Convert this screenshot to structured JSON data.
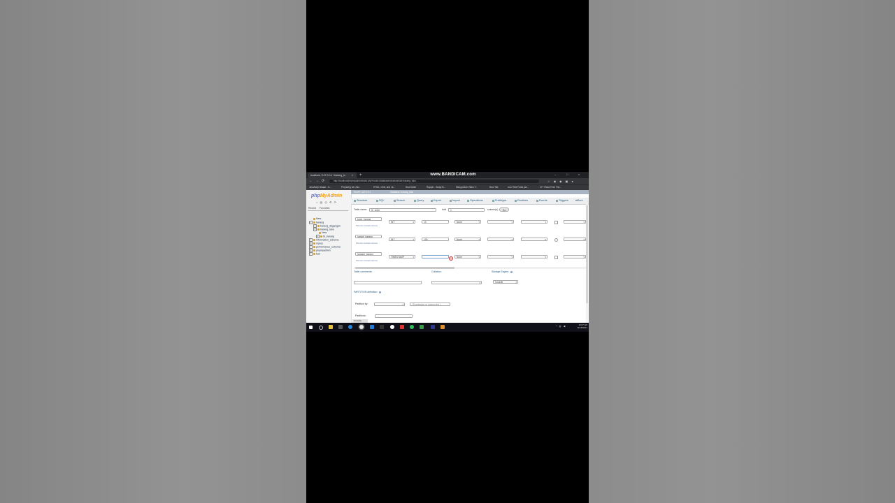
{
  "browser": {
    "tab_title": "localhost / 127.0.0.1 / barang_to",
    "tab_close": "×",
    "new_tab": "+",
    "watermark": "www.BANDICAM.com",
    "window_controls": [
      "–",
      "□",
      "×"
    ],
    "nav_back": "←",
    "nav_forward": "→",
    "nav_reload": "⟳",
    "url": "http://localhost/phpmyadmin/index.php?route=/database/structure&db=barang_toko",
    "bookmarks": [
      "JavaScript Dasar - S...",
      "Preparing for Univ...",
      "HTML, CSS, and Ja...",
      "New folder",
      "Rapper - Sulap B...",
      "Mengunduh Video Y...",
      "New Tab",
      "Cool Text Fonts (ae...",
      "27+ React Free The..."
    ]
  },
  "sidebar": {
    "logo_php": "php",
    "logo_myadmin": "MyAdmin",
    "tools": "⌂ ▤ ◎ ⚙ ⟳",
    "recent": "Recent",
    "favorites": "Favorites",
    "tree": [
      "New",
      "barang",
      "barang_dagangan",
      "barang_toko",
      "New",
      "tb_barang",
      "information_schema",
      "mysql",
      "performance_schema",
      "phpmyadmin",
      "test"
    ]
  },
  "breadcrumb": {
    "server": "Server: 127.0.0.1",
    "database": "Database: barang_toko"
  },
  "tabs": [
    "Structure",
    "SQL",
    "Search",
    "Query",
    "Export",
    "Import",
    "Operations",
    "Privileges",
    "Routines",
    "Events",
    "Triggers",
    "More"
  ],
  "form": {
    "table_name_label": "Table name:",
    "table_name_value": "tb_order",
    "add_label": "Add",
    "add_value": "1",
    "columns_label": "column(s)",
    "go": "Go",
    "hint": "Pick from Central Columns",
    "rows": [
      {
        "name": "kode_barang",
        "type": "INT",
        "length": "10",
        "default": "None"
      },
      {
        "name": "jumlah_barang",
        "type": "INT",
        "length": "100",
        "default": "None"
      },
      {
        "name": "tanggal_barang",
        "type": "TIMESTAMP",
        "length": "",
        "default": "None"
      }
    ],
    "table_comments": "Table comments:",
    "collation": "Collation:",
    "storage_engine": "Storage Engine:",
    "engine_value": "InnoDB",
    "partition_definition": "PARTITION definition:",
    "partition_by": "Partition by:",
    "expression": "( Expression or column list )",
    "partitions": "Partitions:",
    "console": "Console"
  },
  "taskbar": {
    "time": "10:07 AM",
    "date": "11/18/2021"
  },
  "colors": {
    "chrome_dark": "#202124",
    "chrome_mid": "#35363a",
    "pma_blue": "#235a81",
    "logo_blue": "#6c78af",
    "logo_orange": "#f89c0e"
  }
}
